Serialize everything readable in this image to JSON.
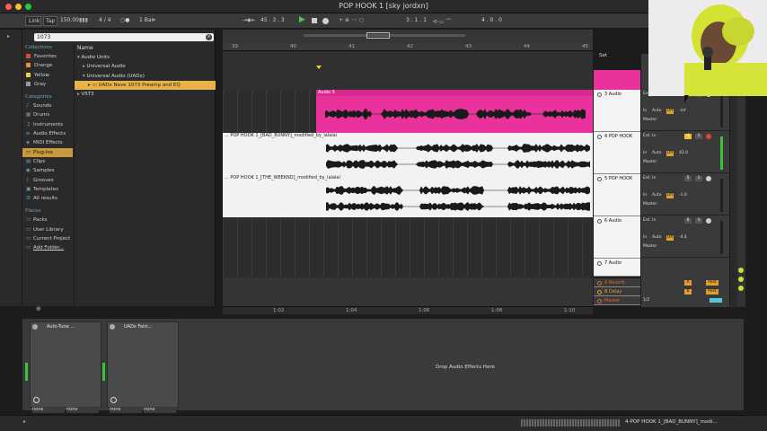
{
  "window": {
    "title": "POP HOOK 1  [sky jordxn]"
  },
  "transport": {
    "link": "Link",
    "tap": "Tap",
    "tempo": "150.00",
    "time_sig": "4 / 4",
    "quantize": "1 Bar",
    "position": "45 .  3 .  3",
    "loop_start": "3 .  1 .  1",
    "loop_length": "4 .  0 .  0"
  },
  "browser": {
    "search_value": "1073",
    "collections_header": "Collections",
    "collections": [
      {
        "label": "Favorites",
        "color": "#e0453a"
      },
      {
        "label": "Orange",
        "color": "#e8913a"
      },
      {
        "label": "Yellow",
        "color": "#e7d23a"
      },
      {
        "label": "Gray",
        "color": "#9a9a9a"
      }
    ],
    "categories_header": "Categories",
    "categories": [
      "Sounds",
      "Drums",
      "Instruments",
      "Audio Effects",
      "MIDI Effects",
      "Plug-Ins",
      "Clips",
      "Samples",
      "Grooves",
      "Templates",
      "All results"
    ],
    "places_header": "Places",
    "places": [
      "Packs",
      "User Library",
      "Current Project",
      "Add Folder..."
    ],
    "name_header": "Name",
    "tree": [
      "Audio Units",
      "Universal Audio",
      "Universal Audio (UADx)",
      "UADx Neve 1073 Preamp and EQ",
      "VST3"
    ]
  },
  "ruler": {
    "bars": [
      "39",
      "40",
      "41",
      "42",
      "43",
      "44",
      "45"
    ],
    "times": [
      "1:02",
      "1:04",
      "1:06",
      "1:08",
      "1:10"
    ]
  },
  "clips": {
    "audio5": "Audio 5",
    "badbunny": "... POP HOOK 1_[BAD_BUNNY]_modified_by_lalalai",
    "weeknd": "... POP HOOK 1_[THE_WEEKND]_modified_by_lalalai"
  },
  "tracks": [
    {
      "name": "3 Audio",
      "color": "#e9329b"
    },
    {
      "name": "4 POP HOOK",
      "color": "#f4f4f4"
    },
    {
      "name": "5 POP HOOK",
      "color": "#f4f4f4"
    },
    {
      "name": "6 Audio",
      "color": "#f4f4f4"
    },
    {
      "name": "7 Audio",
      "color": "#f4f4f4"
    }
  ],
  "returns": [
    {
      "name": "A Reverb",
      "color": "#d07030"
    },
    {
      "name": "B Delay",
      "color": "#e0a030"
    },
    {
      "name": "Master",
      "color": "#e0643a"
    }
  ],
  "mixer": {
    "set_label": "Set",
    "input": "Ext. In",
    "monitor_auto": "Auto",
    "monitor_in": "In",
    "monitor_off": "Off",
    "output": "Master",
    "values": [
      "-inf",
      "42.0",
      "-1.0",
      "-4.4",
      "-inf"
    ],
    "post": "Post",
    "tracks_numbers": [
      "3",
      "4",
      "5",
      "6",
      "7"
    ],
    "sends": [
      "A",
      "B"
    ]
  },
  "devices": {
    "device1": "Auto-Tune ...",
    "device2": "UADx Fairc...",
    "none": "none",
    "drop_hint": "Drop Audio Effects Here"
  },
  "status": {
    "selected": "4-POP HOOK 1_[BAD_BUNNY]_modi..."
  }
}
